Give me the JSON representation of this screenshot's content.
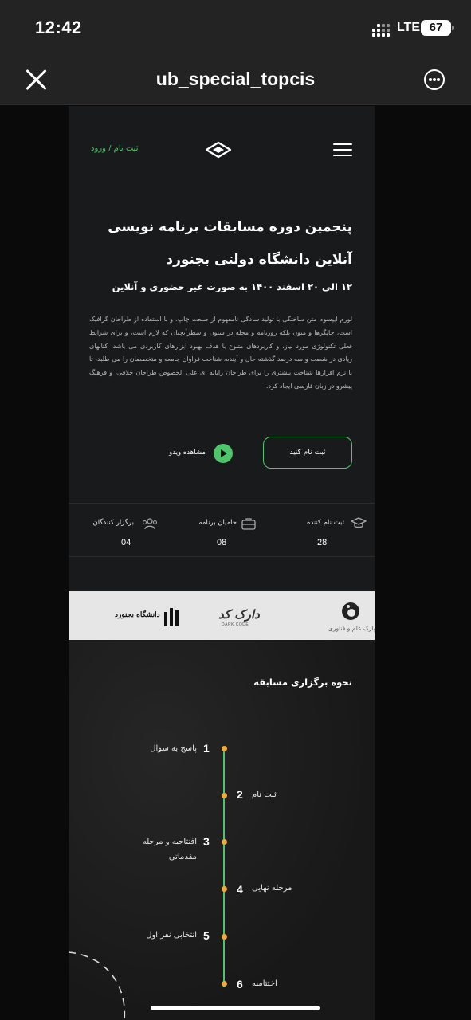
{
  "status_bar": {
    "time": "12:42",
    "network": "LTE",
    "battery": "67"
  },
  "browser": {
    "title": "ub_special_topcis"
  },
  "header": {
    "login_link": "ثبت نام / ورود"
  },
  "hero": {
    "title_line1": "پنجمین دوره مسابقات برنامه نویسی",
    "title_line2": "آنلاین دانشگاه دولتی بجنورد",
    "subtitle": "۱۲ الی ۲۰ اسفند ۱۴۰۰ به صورت غیر حضوری و آنلاین",
    "description": "لورم ایپسوم متن ساختگی با تولید سادگی نامفهوم از صنعت چاپ، و با استفاده از طراحان گرافیک است، چاپگرها و متون بلکه روزنامه و مجله در ستون و سطرآنچنان که لازم است، و برای شرایط فعلی تکنولوژی مورد نیاز، و کاربردهای متنوع با هدف بهبود ابزارهای کاربردی می باشد، کتابهای زیادی در شصت و سه درصد گذشته حال و آینده، شناخت فراوان جامعه و متخصصان را می طلبد، تا با نرم افزارها شناخت بیشتری را برای طراحان رایانه ای علی الخصوص طراحان خلاقی، و فرهنگ پیشرو در زبان فارسی ایجاد کرد.",
    "register_button": "ثبت نام کنید",
    "video_link": "مشاهده ویدو"
  },
  "stats": [
    {
      "label": "ثبت نام کننده",
      "value": "28",
      "icon": "graduation-cap-icon"
    },
    {
      "label": "حامیان برنامه",
      "value": "08",
      "icon": "briefcase-icon"
    },
    {
      "label": "برگزار کنندگان",
      "value": "04",
      "icon": "users-icon"
    }
  ],
  "sponsors": {
    "bojnord": "دانشگاه بجنورد",
    "dark_code": "دارک کد",
    "dark_code_sub": "DARK CODE",
    "science_park": "پارک علم و فناوری"
  },
  "process": {
    "title": "نحوه برگزاری مسابقه",
    "steps": [
      {
        "num": "1",
        "label": "پاسخ به سوال"
      },
      {
        "num": "2",
        "label": "ثبت نام"
      },
      {
        "num": "3",
        "label_line1": "افتتاحیه و مرحله",
        "label_line2": "مقدماتی"
      },
      {
        "num": "4",
        "label": "مرحله نهایی"
      },
      {
        "num": "5",
        "label": "انتخابی نفر اول"
      },
      {
        "num": "6",
        "label": "اختتامیه"
      }
    ]
  },
  "colors": {
    "accent": "#4fc56b",
    "timeline_dot": "#f0a93b",
    "background": "#1a1b1d"
  }
}
